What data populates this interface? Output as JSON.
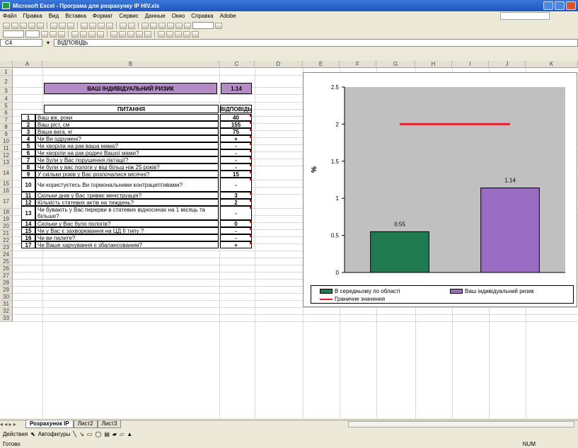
{
  "window": {
    "title": "Microsoft Excel - Програма для розрахунку ІР HIV.xls"
  },
  "menu": [
    "Файл",
    "Правка",
    "Вид",
    "Вставка",
    "Формат",
    "Сервис",
    "Данные",
    "Окно",
    "Справка",
    "Adobe"
  ],
  "formula_bar": {
    "name_box": "C4",
    "content": "ВІДПОВІДЬ"
  },
  "columns": [
    "A",
    "B",
    "C",
    "D",
    "E",
    "F",
    "G",
    "H",
    "I",
    "J",
    "K"
  ],
  "rows": [
    "1",
    "2",
    "3",
    "4",
    "5",
    "6",
    "7",
    "8",
    "9",
    "10",
    "11",
    "12",
    "13",
    "14",
    "15",
    "16",
    "17",
    "18",
    "19",
    "20",
    "21",
    "22",
    "23",
    "24",
    "25",
    "26",
    "27",
    "28",
    "29",
    "30",
    "31",
    "32",
    "33"
  ],
  "header": {
    "label": "ВАШ ІНДИВІДУАЛЬНИЙ РИЗИК",
    "value": "1.14"
  },
  "table": {
    "col_question": "ПИТАННЯ",
    "col_answer": "ВІДПОВІДЬ",
    "rows": [
      {
        "n": "1",
        "q": "Ваш вік, роки",
        "a": "40"
      },
      {
        "n": "2",
        "q": "Ваш ріст, см",
        "a": "155"
      },
      {
        "n": "3",
        "q": "Ваша вага, кг",
        "a": "75"
      },
      {
        "n": "4",
        "q": "Чи Ви одружені?",
        "a": "+"
      },
      {
        "n": "5",
        "q": "Чи хворіла на рак ваша мама?",
        "a": "-"
      },
      {
        "n": "6",
        "q": "Чи хворіли на рак родичі Вашої мами?",
        "a": "-"
      },
      {
        "n": "7",
        "q": "Чи були у Вас порушення ліктації?",
        "a": "-"
      },
      {
        "n": "8",
        "q": "Чи були у вас пологи у віці більш ніж 25 років?",
        "a": "-"
      },
      {
        "n": "9",
        "q": "У скільки років у Вас розпочалися місячні?",
        "a": "15"
      },
      {
        "n": "10",
        "q": "Чи користуєтесь Ви гормональними контрацептивами?",
        "a": "-"
      },
      {
        "n": "11",
        "q": "Скільки днів у Вас триває менструація?",
        "a": "3"
      },
      {
        "n": "12",
        "q": "Кількість статевих актів на тиждень?",
        "a": "2"
      },
      {
        "n": "13",
        "q": "Чи бувають у Вас перерви в статевих відносинах на 1 місяць та більше?",
        "a": "-"
      },
      {
        "n": "14",
        "q": "Скільки у Вас було пологів?",
        "a": "0"
      },
      {
        "n": "15",
        "q": "Чи у Вас є захворювання на ЦД II типу ?",
        "a": "-"
      },
      {
        "n": "16",
        "q": "Чи ви палите?",
        "a": "-"
      },
      {
        "n": "17",
        "q": "Чи Ваше харчування є збалансованим?",
        "a": "+"
      }
    ]
  },
  "chart_data": {
    "type": "bar",
    "categories": [
      "В середньому по області",
      "Ваш індивідуальний ризик"
    ],
    "values": [
      0.55,
      1.14
    ],
    "data_labels": [
      "0.55",
      "1.14"
    ],
    "bar_colors": [
      "#1f7a4f",
      "#9a6cc4"
    ],
    "limit_line": {
      "name": "Граничне значення",
      "value": 2,
      "color": "#e32222"
    },
    "ylabel": "%",
    "ylim": [
      0,
      2.5
    ],
    "yticks": [
      "0",
      "0.5",
      "1",
      "1.5",
      "2",
      "2.5"
    ],
    "legend": [
      "В середньому по області",
      "Ваш індивідуальний ризик",
      "Граничне значення"
    ],
    "legend_position": "bottom",
    "grid": false
  },
  "sheets": [
    "Розрахунок ІР",
    "Лист2",
    "Лист3"
  ],
  "active_sheet": "Розрахунок ІР",
  "drawbar": {
    "actions": "Действия",
    "autoshapes": "Автофигуры"
  },
  "statusbar": {
    "ready": "Готово",
    "num": "NUM"
  }
}
